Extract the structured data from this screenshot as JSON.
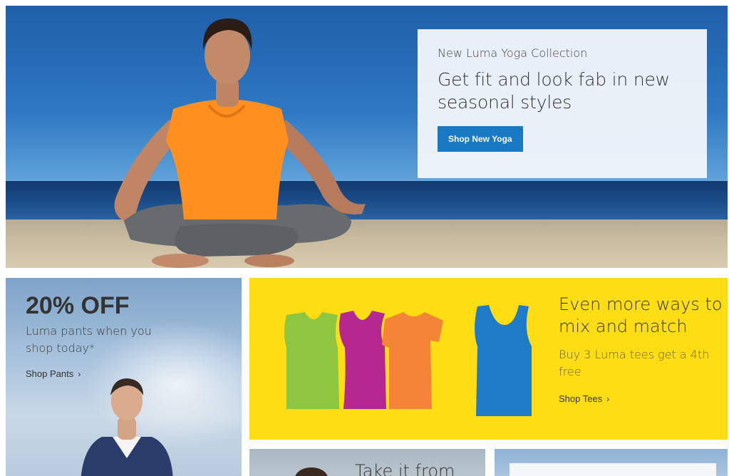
{
  "hero": {
    "kicker": "New Luma Yoga Collection",
    "headline": "Get fit and look fab in new seasonal styles",
    "button_label": "Shop New Yoga"
  },
  "promo_pants": {
    "headline": "20% OFF",
    "subtext": "Luma pants when you shop today*",
    "link_label": "Shop Pants",
    "link_icon": "chevron-right-icon"
  },
  "promo_tees": {
    "headline": "Even more ways to mix and match",
    "subtext": "Buy 3 Luma tees get a 4th free",
    "link_label": "Shop Tees",
    "link_icon": "chevron-right-icon",
    "shirt_colors": [
      "#8dc63f",
      "#b5288f",
      "#f58536",
      "#1e7bc7"
    ],
    "background_color": "#ffdd14"
  },
  "tile_bottom_left": {
    "headline": "Take it from"
  },
  "colors": {
    "accent": "#1979c3"
  }
}
